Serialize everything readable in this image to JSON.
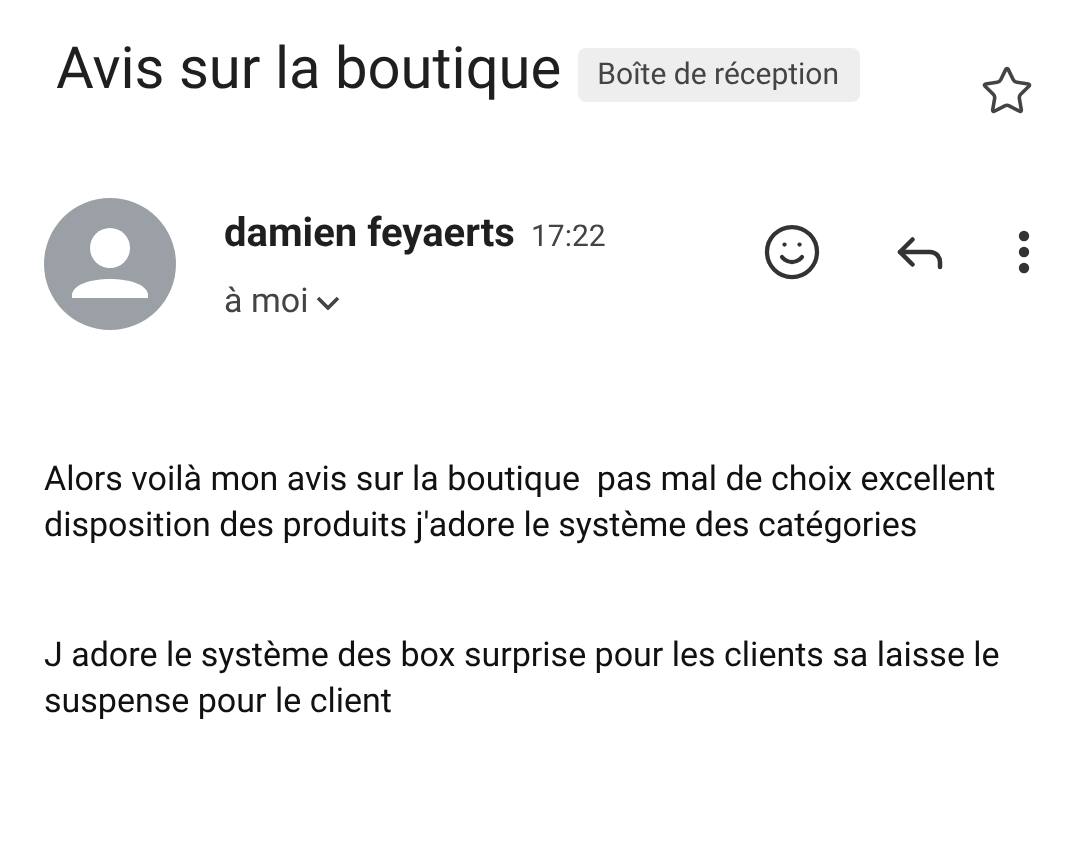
{
  "subject": "Avis sur la boutique",
  "label": "Boîte de réception",
  "starred": false,
  "message": {
    "sender": "damien feyaerts",
    "time": "17:22",
    "recipient": "à moi",
    "paragraphs": [
      "Alors voilà mon avis sur la boutique  pas mal de choix excellent disposition des produits j'adore le système des catégories",
      "J adore le système des box surprise pour les clients sa laisse le suspense pour le client"
    ]
  }
}
